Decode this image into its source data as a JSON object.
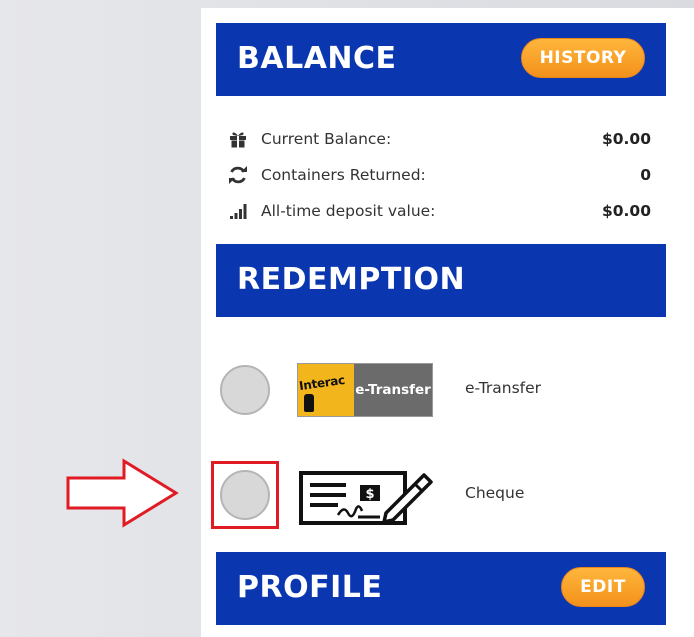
{
  "balance": {
    "title": "BALANCE",
    "history_label": "HISTORY",
    "rows": [
      {
        "icon": "gift-icon",
        "label": "Current Balance:",
        "value": "$0.00"
      },
      {
        "icon": "refresh-icon",
        "label": "Containers Returned:",
        "value": "0"
      },
      {
        "icon": "signal-bars-icon",
        "label": "All-time deposit value:",
        "value": "$0.00"
      }
    ]
  },
  "redemption": {
    "title": "REDEMPTION",
    "options": [
      {
        "label": "e-Transfer",
        "logo_text_left": "Interac",
        "logo_text_right": "e-Transfer"
      },
      {
        "label": "Cheque"
      }
    ]
  },
  "profile": {
    "title": "PROFILE",
    "edit_label": "EDIT"
  },
  "colors": {
    "header_blue": "#0a36b0",
    "button_orange": "#f3911b",
    "annotation_red": "#e01b24"
  }
}
